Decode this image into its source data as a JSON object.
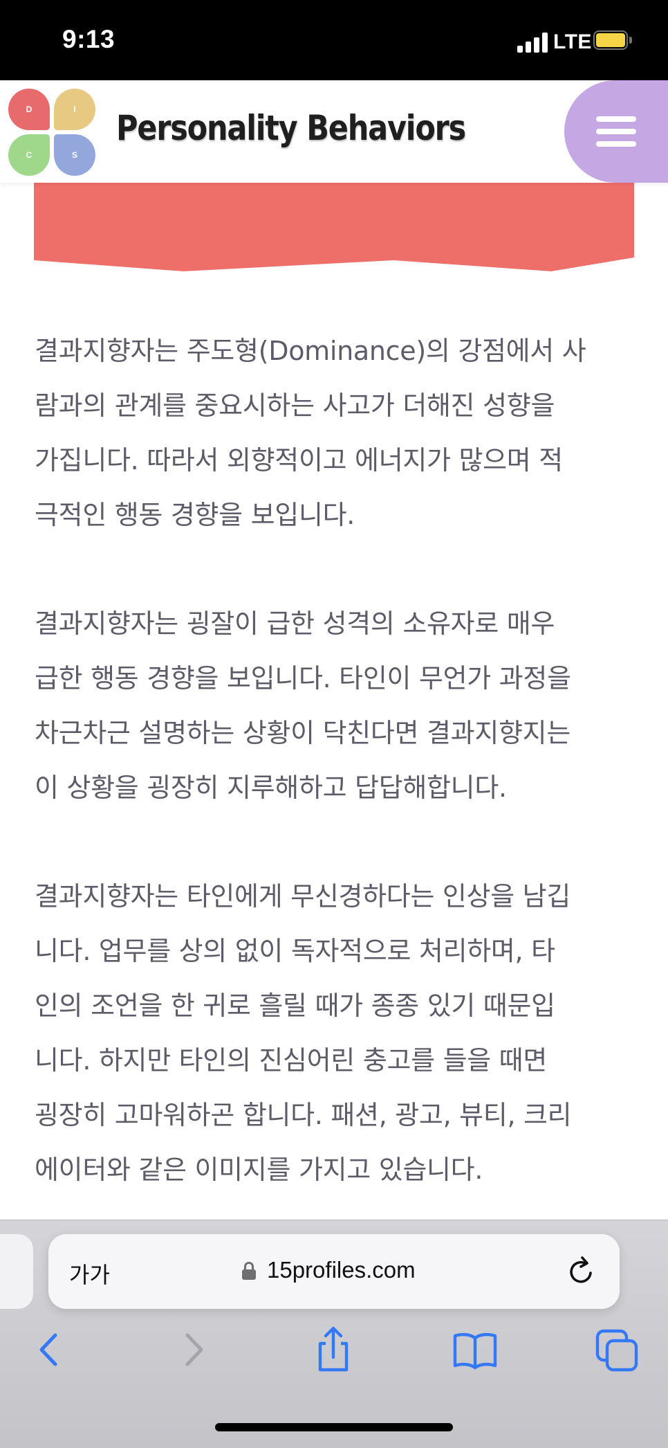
{
  "status_bar": {
    "time": "9:13",
    "network": "LTE",
    "battery_color": "#f5d547"
  },
  "site": {
    "title": "Personality Behaviors",
    "logo_letters": {
      "d": "D",
      "i": "I",
      "c": "C",
      "s": "S"
    },
    "colors": {
      "d": "#e76a6d",
      "i": "#e7c982",
      "c": "#9fd88a",
      "s": "#93a7dc",
      "menu": "#c5a7e3",
      "banner": "#ee6e6a"
    },
    "menu_icon": "hamburger-icon"
  },
  "article": {
    "paragraphs": [
      "결과지향자는 주도형(Dominance)의 강점에서 사\n람과의 관계를 중요시하는 사고가 더해진 성향을\n가집니다. 따라서 외향적이고 에너지가 많으며 적\n극적인 행동 경향을 보입니다.",
      "결과지향자는 굉잘이 급한 성격의 소유자로 매우\n급한 행동 경향을 보입니다. 타인이 무언가 과정을\n차근차근 설명하는 상황이 닥친다면 결과지향지는\n이 상황을 굉장히 지루해하고 답답해합니다.",
      "결과지향자는 타인에게 무신경하다는 인상을 남깁\n니다. 업무를 상의 없이 독자적으로 처리하며, 타\n인의 조언을 한 귀로 흘릴 때가 종종 있기 때문입\n니다. 하지만 타인의 진심어린 충고를 들을 때면\n굉장히 고마워하곤 합니다. 패션, 광고, 뷰티, 크리\n에이터와 같은 이미지를 가지고 있습니다."
    ]
  },
  "browser": {
    "text_size_button": "가가",
    "url": "15profiles.com",
    "accent_color": "#3478f6",
    "icons": [
      "back-icon",
      "forward-icon",
      "share-icon",
      "bookmarks-icon",
      "tabs-icon"
    ]
  }
}
